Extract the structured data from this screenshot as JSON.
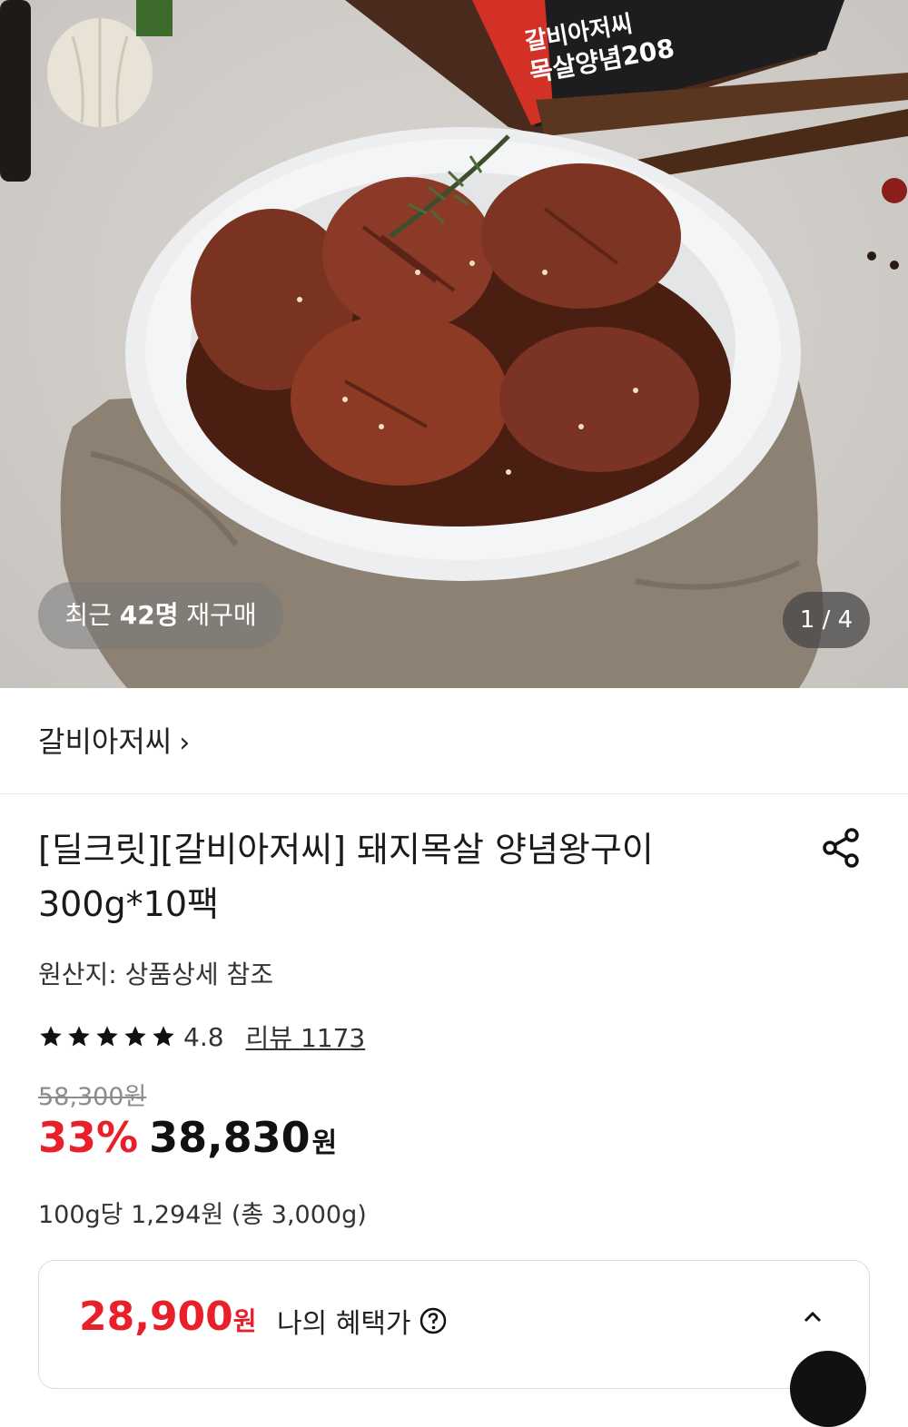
{
  "gallery": {
    "repurchase_prefix": "최근",
    "repurchase_count": "42명",
    "repurchase_suffix": "재구매",
    "page_indicator": "1 / 4",
    "package_label_line1": "갈비아저씨",
    "package_label_line2": "목살양념208"
  },
  "brand": {
    "name": "갈비아저씨",
    "chevron": "›"
  },
  "product": {
    "title_line1": "[딜크릿][갈비아저씨] 돼지목살 양념왕구이",
    "title_line2": "300g*10팩",
    "origin": "원산지: 상품상세 참조",
    "rating": "4.8",
    "rating_value": 4.8,
    "review_label": "리뷰 1173",
    "original_price": "58,300원",
    "discount": "33%",
    "price": "38,830",
    "price_unit": "원",
    "per_unit": "100g당 1,294원 (총 3,000g)"
  },
  "benefit": {
    "price": "28,900",
    "unit": "원",
    "label": "나의 혜택가",
    "help_icon": "question-circle-icon",
    "toggle_icon": "chevron-up-icon"
  },
  "colors": {
    "accent": "#e8202a",
    "text": "#111111",
    "muted": "#8c8c8c"
  }
}
